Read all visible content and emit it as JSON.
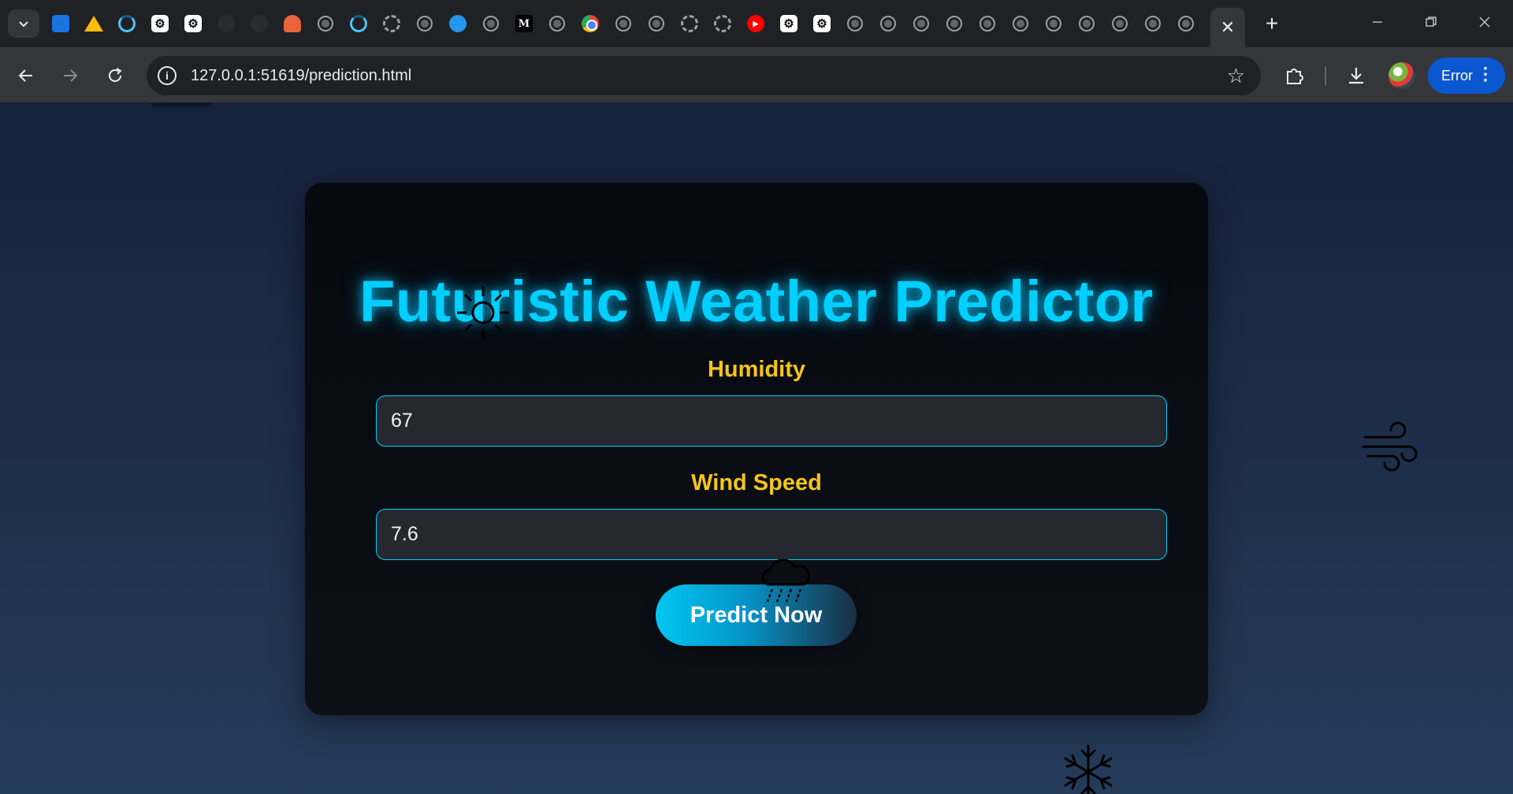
{
  "browser": {
    "tabs": [
      {
        "icon": "contacts-icon"
      },
      {
        "icon": "google-drive-icon"
      },
      {
        "icon": "loading-icon"
      },
      {
        "icon": "openai-icon"
      },
      {
        "icon": "openai-icon"
      },
      {
        "icon": "dim-icon"
      },
      {
        "icon": "dim-icon"
      },
      {
        "icon": "orange-app-icon"
      },
      {
        "icon": "globe-icon"
      },
      {
        "icon": "loading-icon"
      },
      {
        "icon": "loading-dashed-icon"
      },
      {
        "icon": "globe-icon"
      },
      {
        "icon": "docker-icon"
      },
      {
        "icon": "globe-icon"
      },
      {
        "icon": "medium-icon"
      },
      {
        "icon": "globe-icon"
      },
      {
        "icon": "chrome-icon"
      },
      {
        "icon": "globe-icon"
      },
      {
        "icon": "globe-icon"
      },
      {
        "icon": "loading-dashed-icon"
      },
      {
        "icon": "loading-dashed-icon"
      },
      {
        "icon": "youtube-icon"
      },
      {
        "icon": "openai-icon"
      },
      {
        "icon": "openai-icon"
      },
      {
        "icon": "globe-icon"
      },
      {
        "icon": "globe-icon"
      },
      {
        "icon": "globe-icon"
      },
      {
        "icon": "globe-icon"
      },
      {
        "icon": "globe-icon"
      },
      {
        "icon": "globe-icon"
      },
      {
        "icon": "globe-icon"
      },
      {
        "icon": "globe-icon"
      },
      {
        "icon": "globe-icon"
      },
      {
        "icon": "globe-icon"
      },
      {
        "icon": "globe-icon"
      },
      {
        "icon": "globe-icon"
      }
    ],
    "active_tab_close": "✕",
    "new_tab": "+",
    "url": "127.0.0.1:51619/prediction.html",
    "profile_status": "Error"
  },
  "app": {
    "title": "Futuristic Weather Predictor",
    "fields": [
      {
        "label": "Humidity",
        "value": "67"
      },
      {
        "label": "Wind Speed",
        "value": "7.6"
      }
    ],
    "button": "Predict Now"
  },
  "colors": {
    "title": "#00cfff",
    "labels": "#f5c518",
    "field_border": "#00cfff",
    "card_bg": "#0a0d13",
    "page_bg": "#1d2d48"
  },
  "decorations": [
    "sun-icon",
    "wind-icon",
    "rain-cloud-icon",
    "snowflake-icon"
  ]
}
